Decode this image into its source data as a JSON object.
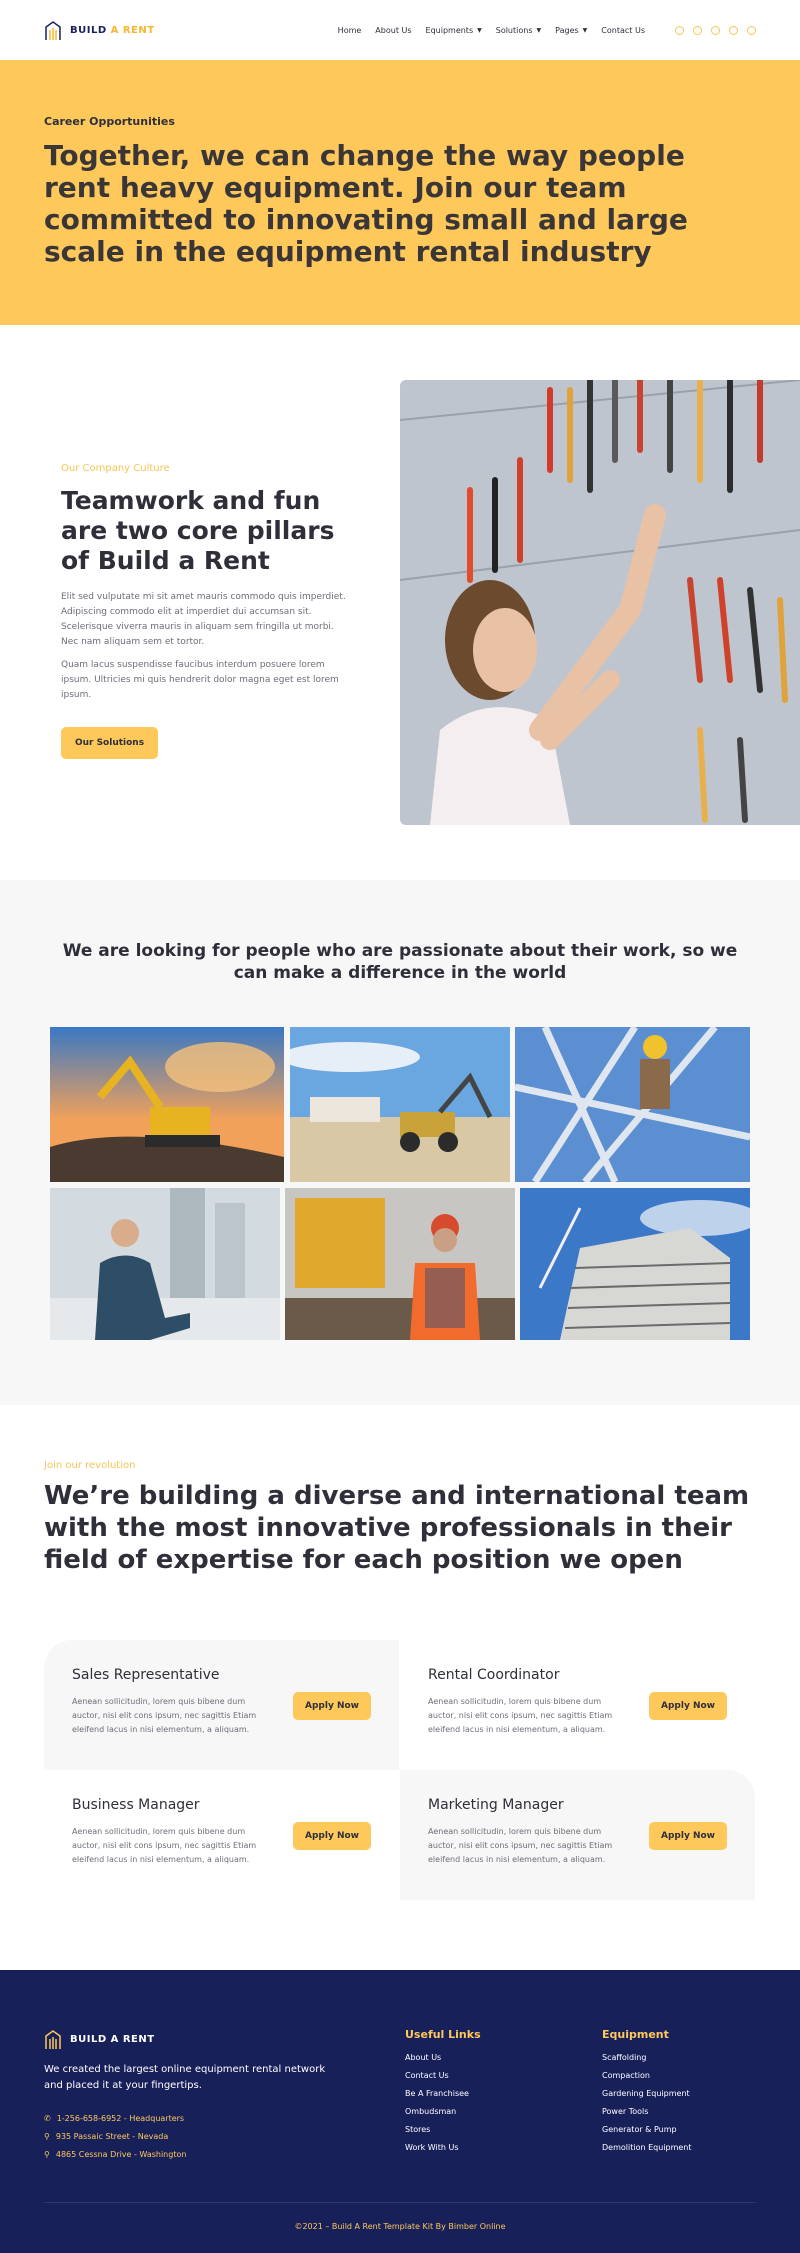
{
  "brand": {
    "name_part1": "BUILD",
    "name_part2": "A RENT",
    "accent_color": "#fec85a",
    "navy_color": "#18205a"
  },
  "nav": {
    "items": [
      {
        "label": "Home"
      },
      {
        "label": "About Us"
      },
      {
        "label": "Equipments",
        "has_dropdown": true
      },
      {
        "label": "Solutions",
        "has_dropdown": true
      },
      {
        "label": "Pages",
        "has_dropdown": true
      },
      {
        "label": "Contact Us"
      }
    ],
    "socials": [
      "instagram-icon",
      "pinterest-icon",
      "twitter-icon",
      "youtube-icon",
      "dribbble-icon"
    ]
  },
  "hero": {
    "eyebrow": "Career Opportunities",
    "title": "Together, we can change the way people rent heavy equipment. Join our team committed to innovating small and large scale in the equipment rental industry"
  },
  "culture": {
    "eyebrow": "Our Company Culture",
    "title": "Teamwork and fun are two core pillars of Build a Rent",
    "para1": "Elit sed vulputate mi sit amet mauris commodo quis imperdiet. Adipiscing commodo elit at imperdiet dui accumsan sit. Scelerisque viverra mauris in aliquam sem fringilla ut morbi. Nec nam aliquam sem et tortor.",
    "para2": "Quam lacus suspendisse faucibus interdum posuere lorem ipsum. Ultricies mi quis hendrerit dolor magna eget est lorem ipsum.",
    "button": "Our Solutions"
  },
  "passion": {
    "title": "We are looking for people who are passionate about their work, so we can make a difference in the world"
  },
  "revolution": {
    "eyebrow": "Join our revolution",
    "title": "We’re building a diverse and international team with the most innovative professionals in their field of expertise for each position we open"
  },
  "jobs": [
    {
      "title": "Sales Representative",
      "desc": "Aenean sollicitudin, lorem quis bibene dum auctor, nisi elit cons ipsum, nec sagittis Etiam eleifend lacus in nisi elementum, a aliquam.",
      "button": "Apply Now"
    },
    {
      "title": "Rental Coordinator",
      "desc": "Aenean sollicitudin, lorem quis bibene dum auctor, nisi elit cons ipsum, nec sagittis Etiam eleifend lacus in nisi elementum, a aliquam.",
      "button": "Apply Now"
    },
    {
      "title": "Business Manager",
      "desc": "Aenean sollicitudin, lorem quis bibene dum auctor, nisi elit cons ipsum, nec sagittis Etiam eleifend lacus in nisi elementum, a aliquam.",
      "button": "Apply Now"
    },
    {
      "title": "Marketing Manager",
      "desc": "Aenean sollicitudin, lorem quis bibene dum auctor, nisi elit cons ipsum, nec sagittis Etiam eleifend lacus in nisi elementum, a aliquam.",
      "button": "Apply Now"
    }
  ],
  "footer": {
    "description": "We created the largest online equipment rental network and placed it at your fingertips.",
    "contacts": [
      {
        "icon": "phone-icon",
        "text": "1-256-658-6952 - Headquarters"
      },
      {
        "icon": "map-pin-icon",
        "text": "935 Passaic Street - Nevada"
      },
      {
        "icon": "map-pin-icon",
        "text": "4865 Cessna Drive - Washington"
      }
    ],
    "useful_links": {
      "title": "Useful Links",
      "items": [
        "About Us",
        "Contact Us",
        "Be A Franchisee",
        "Ombudsman",
        "Stores",
        "Work With Us"
      ]
    },
    "equipment": {
      "title": "Equipment",
      "items": [
        "Scaffolding",
        "Compaction",
        "Gardening Equipment",
        "Power Tools",
        "Generator & Pump",
        "Demolition Equipment"
      ]
    },
    "copyright": "©2021 – Build A Rent Template Kit By Bimber Online"
  }
}
